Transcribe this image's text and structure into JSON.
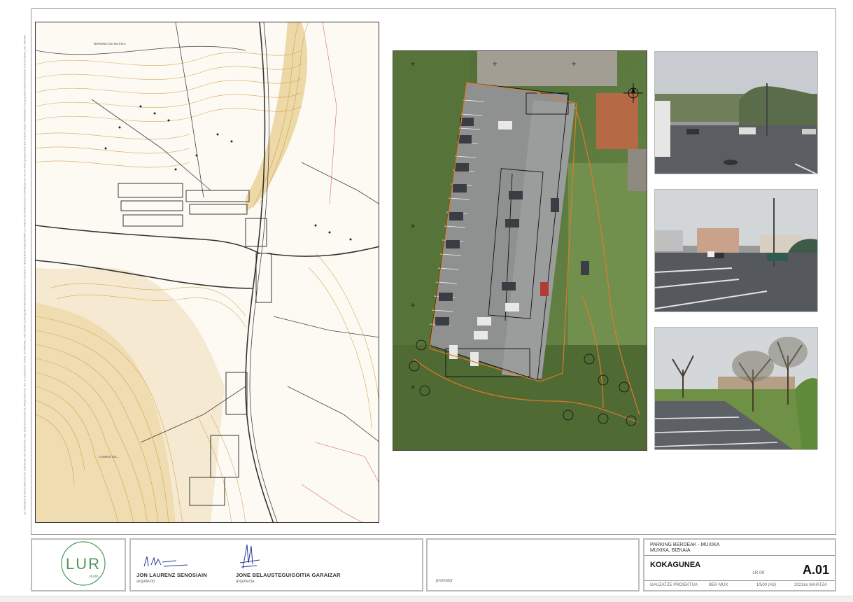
{
  "side_note": "EL PRESENTE DOCUMENTO ES COPIA DE SU ORIGINAL DEL QUE ES AUTOR EL ARQUITECTO. SU UTILIZACIÓN TOTAL O PARCIAL, ASÍ COMO CUALQUIER REPRODUCCIÓN O CESIÓN A TERCEROS REQUERIRÁ LA PREVIA AUTORIZACIÓN EXPRESA DE SU AUTOR QUEDANDO EN TODO CASO PROHIBIDA CUALQUIER MODIFICACIÓN UNILATERAL DEL MISMO",
  "map_labels": {
    "top_label": "TERMINO DE MUXIKA",
    "lower_label": "CAMINO DE..."
  },
  "logo": {
    "text": "LUR",
    "sub": "studio"
  },
  "architects": [
    {
      "name": "JON LAURENZ SENOSIAIN",
      "role": "arquitecto"
    },
    {
      "name": "JONE BELAUSTEGUIGOITIA GARAIZAR",
      "role": "arquitecta"
    }
  ],
  "promotor_label": "promotor",
  "project": {
    "title": "PARKING BERDEAK - MUXIKA",
    "location": "MUXIKA, BIZKAIA",
    "sheet_title": "KOKAGUNEA",
    "revision": "1R.00",
    "sheet_number": "A.01",
    "phase": "GAUZATZE PROIEKTUA",
    "code": "BER MUX",
    "scale": "1/500 (A3)",
    "date": "2021ko MAIATZA"
  },
  "colors": {
    "contour": "#c9962e",
    "road": "#333333",
    "outline": "#e07a2a",
    "grass": "#4f6e35"
  }
}
